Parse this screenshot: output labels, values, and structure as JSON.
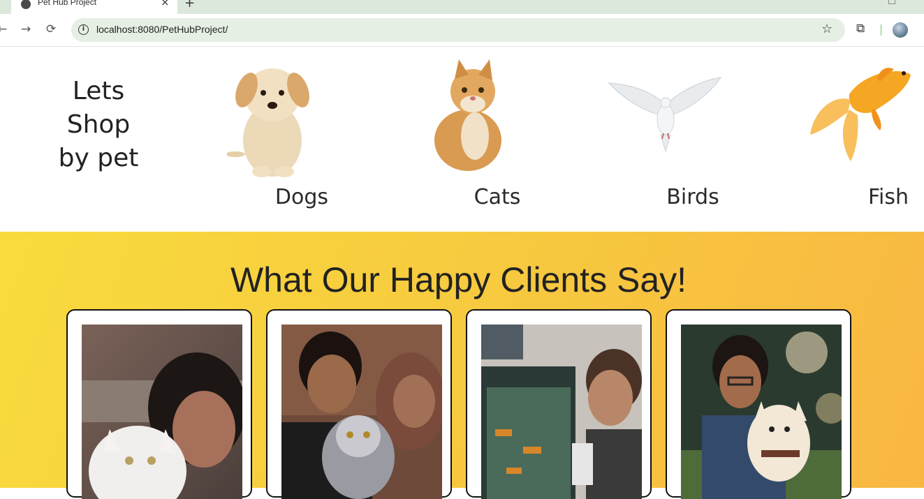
{
  "browser": {
    "tab_title": "Pet Hub Project",
    "url": "localhost:8080/PetHubProject/",
    "tab_close": "×",
    "new_tab": "+",
    "info": "i"
  },
  "shop": {
    "title_lines": [
      "Lets",
      "Shop",
      "by pet"
    ],
    "pets": [
      {
        "label": "Dogs"
      },
      {
        "label": "Cats"
      },
      {
        "label": "Birds"
      },
      {
        "label": "Fish"
      }
    ]
  },
  "testimonials": {
    "heading": "What Our Happy Clients Say!"
  },
  "colors": {
    "yellow_start": "#f8dc3d",
    "yellow_end": "#f9b742"
  }
}
